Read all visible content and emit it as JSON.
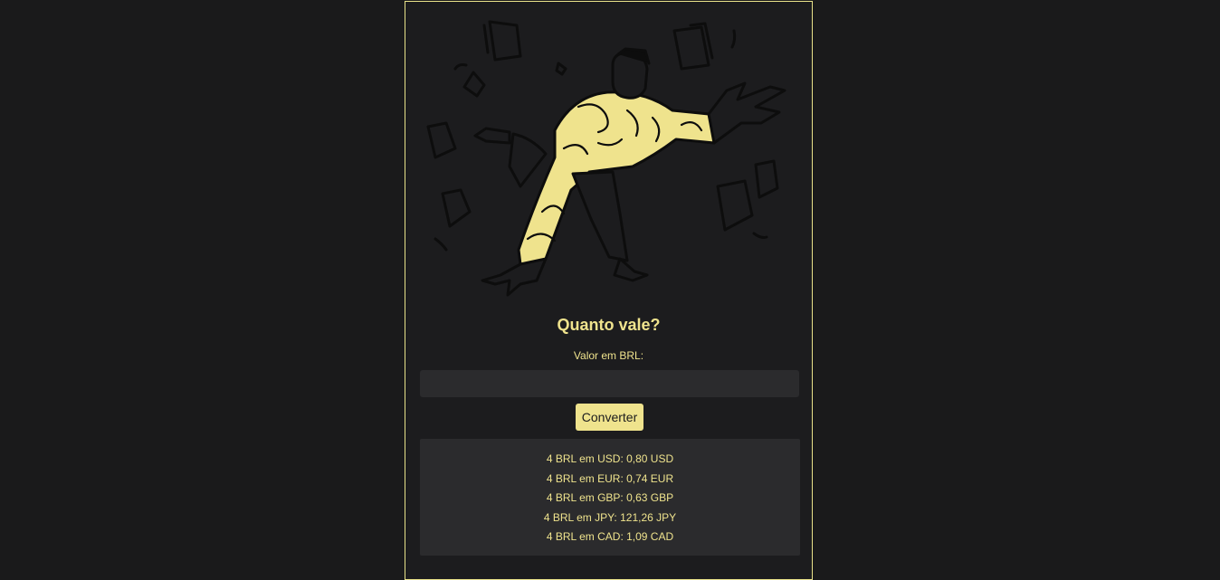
{
  "colors": {
    "background": "#1a1a1b",
    "card": "#1c1c1e",
    "accent": "#efe38d",
    "panel": "#2b2b2d",
    "ink": "#0d0d0d"
  },
  "illustration": {
    "icon": "person-throwing-papers-illustration"
  },
  "form": {
    "title": "Quanto vale?",
    "label": "Valor em BRL:",
    "input_value": "",
    "input_placeholder": "",
    "button_label": "Converter"
  },
  "results": [
    "4 BRL em USD: 0,80 USD",
    "4 BRL em EUR: 0,74 EUR",
    "4 BRL em GBP: 0,63 GBP",
    "4 BRL em JPY: 121,26 JPY",
    "4 BRL em CAD: 1,09 CAD"
  ]
}
